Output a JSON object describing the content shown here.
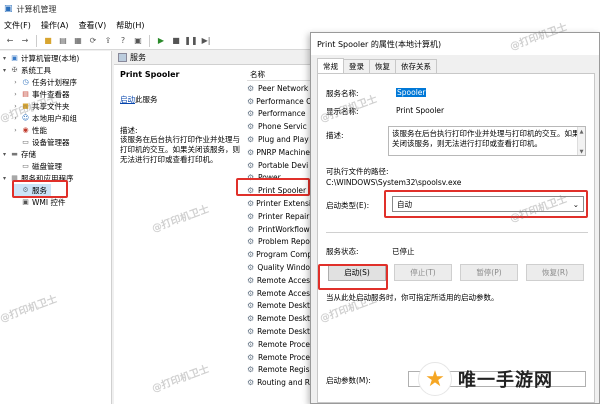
{
  "window": {
    "title": "计算机管理"
  },
  "menu": [
    "文件(F)",
    "操作(A)",
    "查看(V)",
    "帮助(H)"
  ],
  "tree": [
    {
      "label": "计算机管理(本地)",
      "icon": "computer-icon",
      "indent": 0,
      "toggle": "▾"
    },
    {
      "label": "系统工具",
      "icon": "tools-icon",
      "indent": 1,
      "toggle": "▾"
    },
    {
      "label": "任务计划程序",
      "icon": "clock-icon",
      "indent": 2,
      "toggle": "›"
    },
    {
      "label": "事件查看器",
      "icon": "event-log-icon",
      "indent": 2,
      "toggle": "›"
    },
    {
      "label": "共享文件夹",
      "icon": "shared-folder-icon",
      "indent": 2,
      "toggle": "›"
    },
    {
      "label": "本地用户和组",
      "icon": "users-icon",
      "indent": 2,
      "toggle": "›"
    },
    {
      "label": "性能",
      "icon": "performance-icon",
      "indent": 2,
      "toggle": "›"
    },
    {
      "label": "设备管理器",
      "icon": "device-icon",
      "indent": 2,
      "toggle": ""
    },
    {
      "label": "存储",
      "icon": "storage-icon",
      "indent": 1,
      "toggle": "▾"
    },
    {
      "label": "磁盘管理",
      "icon": "disk-icon",
      "indent": 2,
      "toggle": ""
    },
    {
      "label": "服务和应用程序",
      "icon": "apps-icon",
      "indent": 1,
      "toggle": "▾"
    },
    {
      "label": "服务",
      "icon": "services-icon",
      "indent": 2,
      "toggle": ""
    },
    {
      "label": "WMI 控件",
      "icon": "wmi-icon",
      "indent": 2,
      "toggle": ""
    }
  ],
  "middle": {
    "tab_label": "服务",
    "service_name": "Print Spooler",
    "start_link": "启动",
    "start_suffix": "此服务",
    "desc_label": "描述:",
    "desc_text": "该服务在后台执行打印作业并处理与打印机的交互。如果关闭该服务，则无法进行打印或查看打印机。",
    "list_header": "名称",
    "services": [
      "Peer Network",
      "Performance C",
      "Performance",
      "Phone Servic",
      "Plug and Play",
      "PNRP Machine",
      "Portable Devi",
      "Power",
      "Print Spooler",
      "Printer Extensi",
      "Printer Repair",
      "PrintWorkflow",
      "Problem Repo",
      "Program Comp",
      "Quality Windo",
      "Remote Acces",
      "Remote Acces",
      "Remote Deskt",
      "Remote Deskt",
      "Remote Deskt",
      "Remote Proce",
      "Remote Proce",
      "Remote Regis",
      "Routing and R"
    ]
  },
  "dialog": {
    "title": "Print Spooler 的属性(本地计算机)",
    "tabs": [
      "常规",
      "登录",
      "恢复",
      "依存关系"
    ],
    "service_name_label": "服务名称:",
    "service_name_value": "Spooler",
    "display_name_label": "显示名称:",
    "display_name_value": "Print Spooler",
    "desc_label": "描述:",
    "desc_value": "该服务在后台执行打印作业并处理与打印机的交互。如果关闭该服务，则无法进行打印或查看打印机。",
    "path_label": "可执行文件的路径:",
    "path_value": "C:\\WINDOWS\\System32\\spoolsv.exe",
    "startup_type_label": "启动类型(E):",
    "startup_type_value": "自动",
    "status_label": "服务状态:",
    "status_value": "已停止",
    "buttons": {
      "start": "启动(S)",
      "stop": "停止(T)",
      "pause": "暂停(P)",
      "resume": "恢复(R)"
    },
    "hint": "当从此处启动服务时，你可指定所适用的启动参数。",
    "params_label": "启动参数(M):"
  },
  "watermark": {
    "text": "@打印机卫士"
  },
  "logo": {
    "text": "唯一手游网"
  },
  "colors": {
    "highlight": "#e0302a",
    "selection": "#0078d7",
    "link": "#0645ad"
  }
}
